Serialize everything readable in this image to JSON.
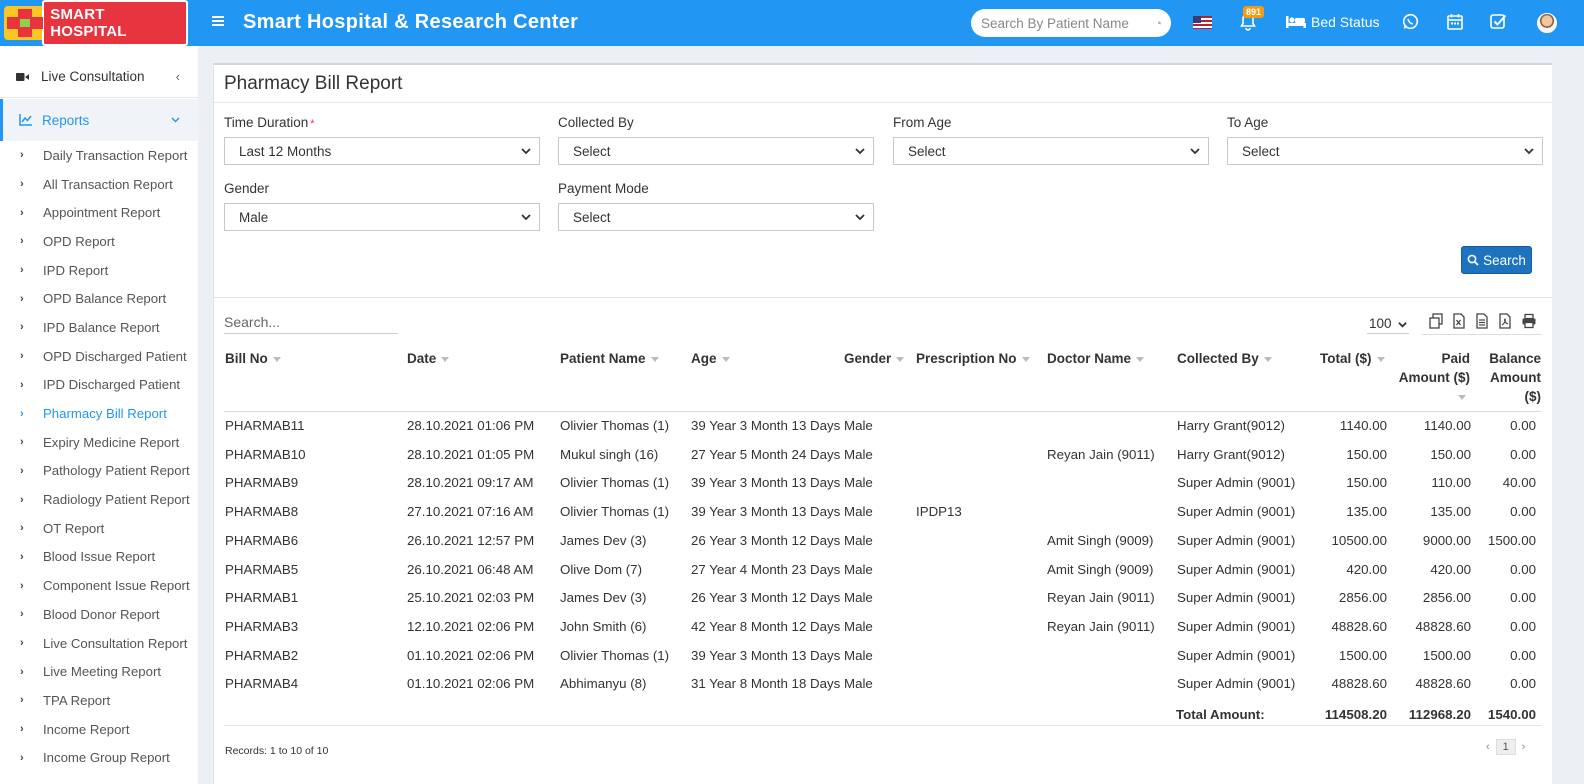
{
  "header": {
    "logo_text": "SMART HOSPITAL",
    "title": "Smart Hospital & Research Center",
    "search_placeholder": "Search By Patient Name",
    "notification_count": "891",
    "bed_status_label": "Bed Status",
    "primary_color": "#2196f3"
  },
  "sidebar": {
    "live_consultation": "Live Consultation",
    "reports": "Reports",
    "items": [
      "Daily Transaction Report",
      "All Transaction Report",
      "Appointment Report",
      "OPD Report",
      "IPD Report",
      "OPD Balance Report",
      "IPD Balance Report",
      "OPD Discharged Patient",
      "IPD Discharged Patient",
      "Pharmacy Bill Report",
      "Expiry Medicine Report",
      "Pathology Patient Report",
      "Radiology Patient Report",
      "OT Report",
      "Blood Issue Report",
      "Component Issue Report",
      "Blood Donor Report",
      "Live Consultation Report",
      "Live Meeting Report",
      "TPA Report",
      "Income Report",
      "Income Group Report"
    ],
    "active_item": "Pharmacy Bill Report"
  },
  "page": {
    "title": "Pharmacy Bill Report",
    "filters": {
      "time_duration": {
        "label": "Time Duration",
        "value": "Last 12 Months"
      },
      "collected_by": {
        "label": "Collected By",
        "value": "Select"
      },
      "from_age": {
        "label": "From Age",
        "value": "Select"
      },
      "to_age": {
        "label": "To Age",
        "value": "Select"
      },
      "gender": {
        "label": "Gender",
        "value": "Male"
      },
      "payment_mode": {
        "label": "Payment Mode",
        "value": "Select"
      }
    },
    "search_button": "Search",
    "table_search_placeholder": "Search...",
    "page_length": "100",
    "columns": {
      "bill_no": "Bill No",
      "date": "Date",
      "patient_name": "Patient Name",
      "age": "Age",
      "gender": "Gender",
      "prescription_no": "Prescription No",
      "doctor_name": "Doctor Name",
      "collected_by": "Collected By",
      "total": "Total ($)",
      "paid_line1": "Paid",
      "paid_line2": "Amount ($)",
      "balance_line1": "Balance",
      "balance_line2": "Amount",
      "balance_line3": "($)"
    },
    "rows": [
      {
        "bill": "PHARMAB11",
        "date": "28.10.2021 01:06 PM",
        "patient": "Olivier Thomas (1)",
        "age": "39 Year 3 Month 13 Days",
        "gender": "Male",
        "prescription": "",
        "doctor": "",
        "collected": "Harry Grant(9012)",
        "total": "1140.00",
        "paid": "1140.00",
        "balance": "0.00"
      },
      {
        "bill": "PHARMAB10",
        "date": "28.10.2021 01:05 PM",
        "patient": "Mukul singh (16)",
        "age": "27 Year 5 Month 24 Days",
        "gender": "Male",
        "prescription": "",
        "doctor": "Reyan Jain (9011)",
        "collected": "Harry Grant(9012)",
        "total": "150.00",
        "paid": "150.00",
        "balance": "0.00"
      },
      {
        "bill": "PHARMAB9",
        "date": "28.10.2021 09:17 AM",
        "patient": "Olivier Thomas (1)",
        "age": "39 Year 3 Month 13 Days",
        "gender": "Male",
        "prescription": "",
        "doctor": "",
        "collected": "Super Admin (9001)",
        "total": "150.00",
        "paid": "110.00",
        "balance": "40.00"
      },
      {
        "bill": "PHARMAB8",
        "date": "27.10.2021 07:16 AM",
        "patient": "Olivier Thomas (1)",
        "age": "39 Year 3 Month 13 Days",
        "gender": "Male",
        "prescription": "IPDP13",
        "doctor": "",
        "collected": "Super Admin (9001)",
        "total": "135.00",
        "paid": "135.00",
        "balance": "0.00"
      },
      {
        "bill": "PHARMAB6",
        "date": "26.10.2021 12:57 PM",
        "patient": "James Dev (3)",
        "age": "26 Year 3 Month 12 Days",
        "gender": "Male",
        "prescription": "",
        "doctor": "Amit Singh (9009)",
        "collected": "Super Admin (9001)",
        "total": "10500.00",
        "paid": "9000.00",
        "balance": "1500.00"
      },
      {
        "bill": "PHARMAB5",
        "date": "26.10.2021 06:48 AM",
        "patient": "Olive Dom (7)",
        "age": "27 Year 4 Month 23 Days",
        "gender": "Male",
        "prescription": "",
        "doctor": "Amit Singh (9009)",
        "collected": "Super Admin (9001)",
        "total": "420.00",
        "paid": "420.00",
        "balance": "0.00"
      },
      {
        "bill": "PHARMAB1",
        "date": "25.10.2021 02:03 PM",
        "patient": "James Dev (3)",
        "age": "26 Year 3 Month 12 Days",
        "gender": "Male",
        "prescription": "",
        "doctor": "Reyan Jain (9011)",
        "collected": "Super Admin (9001)",
        "total": "2856.00",
        "paid": "2856.00",
        "balance": "0.00"
      },
      {
        "bill": "PHARMAB3",
        "date": "12.10.2021 02:06 PM",
        "patient": "John Smith (6)",
        "age": "42 Year 8 Month 12 Days",
        "gender": "Male",
        "prescription": "",
        "doctor": "Reyan Jain (9011)",
        "collected": "Super Admin (9001)",
        "total": "48828.60",
        "paid": "48828.60",
        "balance": "0.00"
      },
      {
        "bill": "PHARMAB2",
        "date": "01.10.2021 02:06 PM",
        "patient": "Olivier Thomas (1)",
        "age": "39 Year 3 Month 13 Days",
        "gender": "Male",
        "prescription": "",
        "doctor": "",
        "collected": "Super Admin (9001)",
        "total": "1500.00",
        "paid": "1500.00",
        "balance": "0.00"
      },
      {
        "bill": "PHARMAB4",
        "date": "01.10.2021 02:06 PM",
        "patient": "Abhimanyu (8)",
        "age": "31 Year 8 Month 18 Days",
        "gender": "Male",
        "prescription": "",
        "doctor": "",
        "collected": "Super Admin (9001)",
        "total": "48828.60",
        "paid": "48828.60",
        "balance": "0.00"
      }
    ],
    "totals": {
      "label": "Total Amount:",
      "total": "114508.20",
      "paid": "112968.20",
      "balance": "1540.00"
    },
    "records_text": "Records: 1 to 10 of 10",
    "current_page": "1"
  }
}
